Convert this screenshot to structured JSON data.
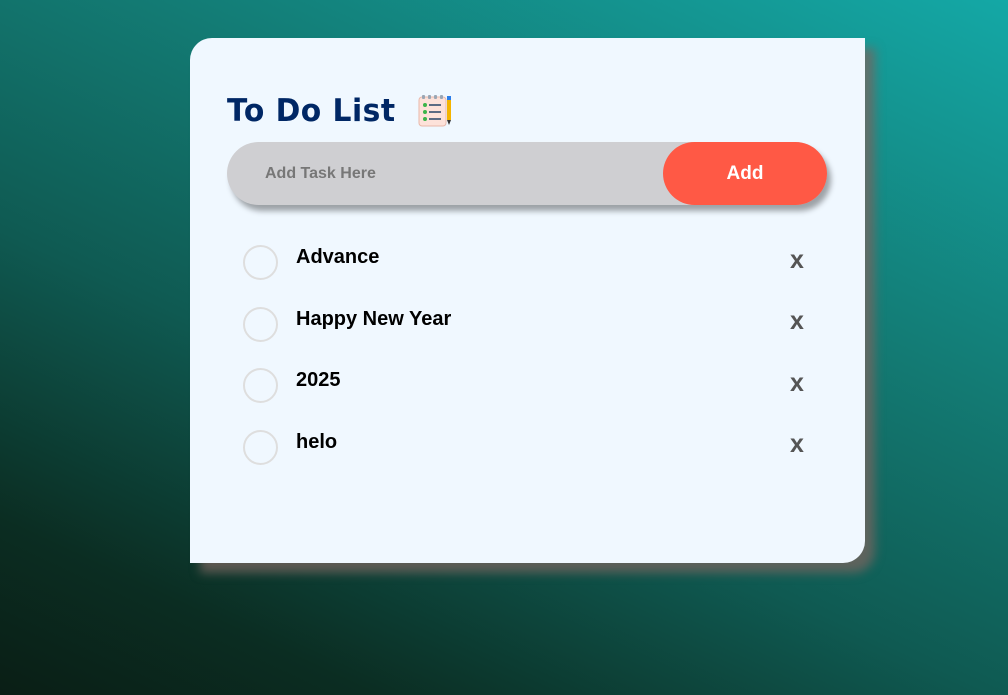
{
  "todo": {
    "title": "To Do List",
    "title_icon": "notepad-checklist-icon",
    "input": {
      "placeholder": "Add Task Here",
      "value": ""
    },
    "add_label": "Add",
    "tasks": [
      {
        "text": "Advance",
        "completed": false,
        "delete_label": "x"
      },
      {
        "text": "Happy New Year",
        "completed": false,
        "delete_label": "x"
      },
      {
        "text": "2025",
        "completed": false,
        "delete_label": "x"
      },
      {
        "text": "helo",
        "completed": false,
        "delete_label": "x"
      }
    ]
  },
  "colors": {
    "title": "#002765",
    "add_button": "#ff5945",
    "card_background": "#f0f8ff",
    "input_background": "#cfcfd2",
    "delete_icon": "#555555"
  }
}
